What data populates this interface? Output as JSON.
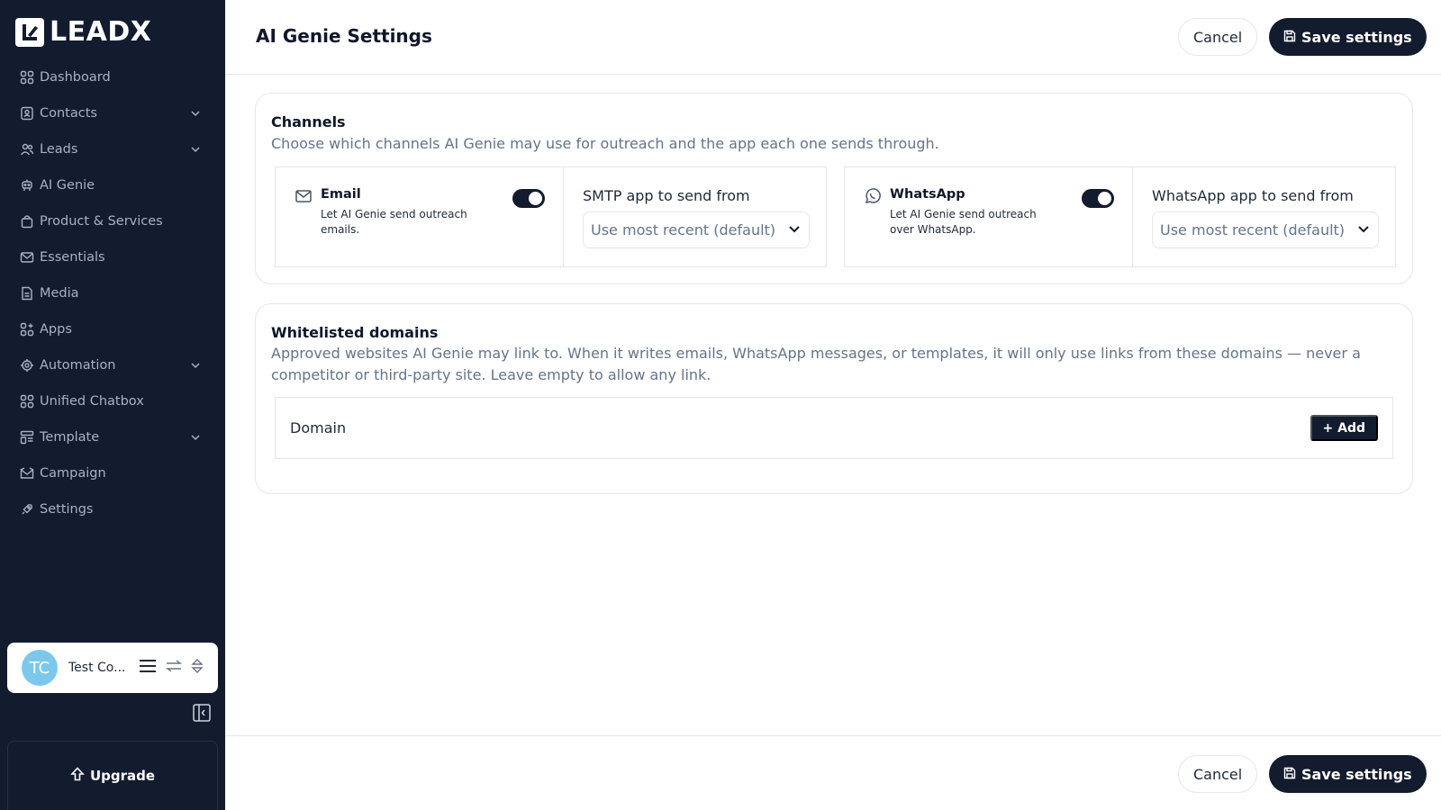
{
  "brand": {
    "name": "LEADX"
  },
  "sidebar": {
    "items": [
      {
        "label": "Dashboard",
        "icon": "grid-icon",
        "has_chevron": false
      },
      {
        "label": "Contacts",
        "icon": "contact-card-icon",
        "has_chevron": true
      },
      {
        "label": "Leads",
        "icon": "users-icon",
        "has_chevron": true
      },
      {
        "label": "AI Genie",
        "icon": "bot-icon",
        "has_chevron": false
      },
      {
        "label": "Product & Services",
        "icon": "bag-icon",
        "has_chevron": false
      },
      {
        "label": "Essentials",
        "icon": "mail-icon",
        "has_chevron": false
      },
      {
        "label": "Media",
        "icon": "file-icon",
        "has_chevron": false
      },
      {
        "label": "Apps",
        "icon": "apps-icon",
        "has_chevron": false
      },
      {
        "label": "Automation",
        "icon": "gear-bot-icon",
        "has_chevron": true
      },
      {
        "label": "Unified Chatbox",
        "icon": "grid-icon",
        "has_chevron": false
      },
      {
        "label": "Template",
        "icon": "template-icon",
        "has_chevron": true
      },
      {
        "label": "Campaign",
        "icon": "campaign-icon",
        "has_chevron": false
      },
      {
        "label": "Settings",
        "icon": "rocket-icon",
        "has_chevron": false
      }
    ],
    "user": {
      "initials": "TC",
      "name": "Test Co..."
    },
    "upgrade_label": "Upgrade"
  },
  "header": {
    "title": "AI Genie Settings",
    "cancel_label": "Cancel",
    "save_label": "Save settings"
  },
  "channels": {
    "title": "Channels",
    "description": "Choose which channels AI Genie may use for outreach and the app each one sends through.",
    "email": {
      "name": "Email",
      "description": "Let AI Genie send outreach emails.",
      "enabled": true,
      "select_label": "SMTP app to send from",
      "select_value": "Use most recent (default)"
    },
    "whatsapp": {
      "name": "WhatsApp",
      "description": "Let AI Genie send outreach over WhatsApp.",
      "enabled": true,
      "select_label": "WhatsApp app to send from",
      "select_value": "Use most recent (default)"
    }
  },
  "whitelist": {
    "title": "Whitelisted domains",
    "description": "Approved websites AI Genie may link to. When it writes emails, WhatsApp messages, or templates, it will only use links from these domains — never a competitor or third-party site. Leave empty to allow any link.",
    "domain_label": "Domain",
    "add_label": "+ Add"
  },
  "footer": {
    "cancel_label": "Cancel",
    "save_label": "Save settings"
  },
  "colors": {
    "sidebar_bg": "#131b2e",
    "primary": "#131b2e",
    "muted_text": "#64748b",
    "border": "#e5e7eb",
    "avatar_bg": "#7cc8ec"
  }
}
